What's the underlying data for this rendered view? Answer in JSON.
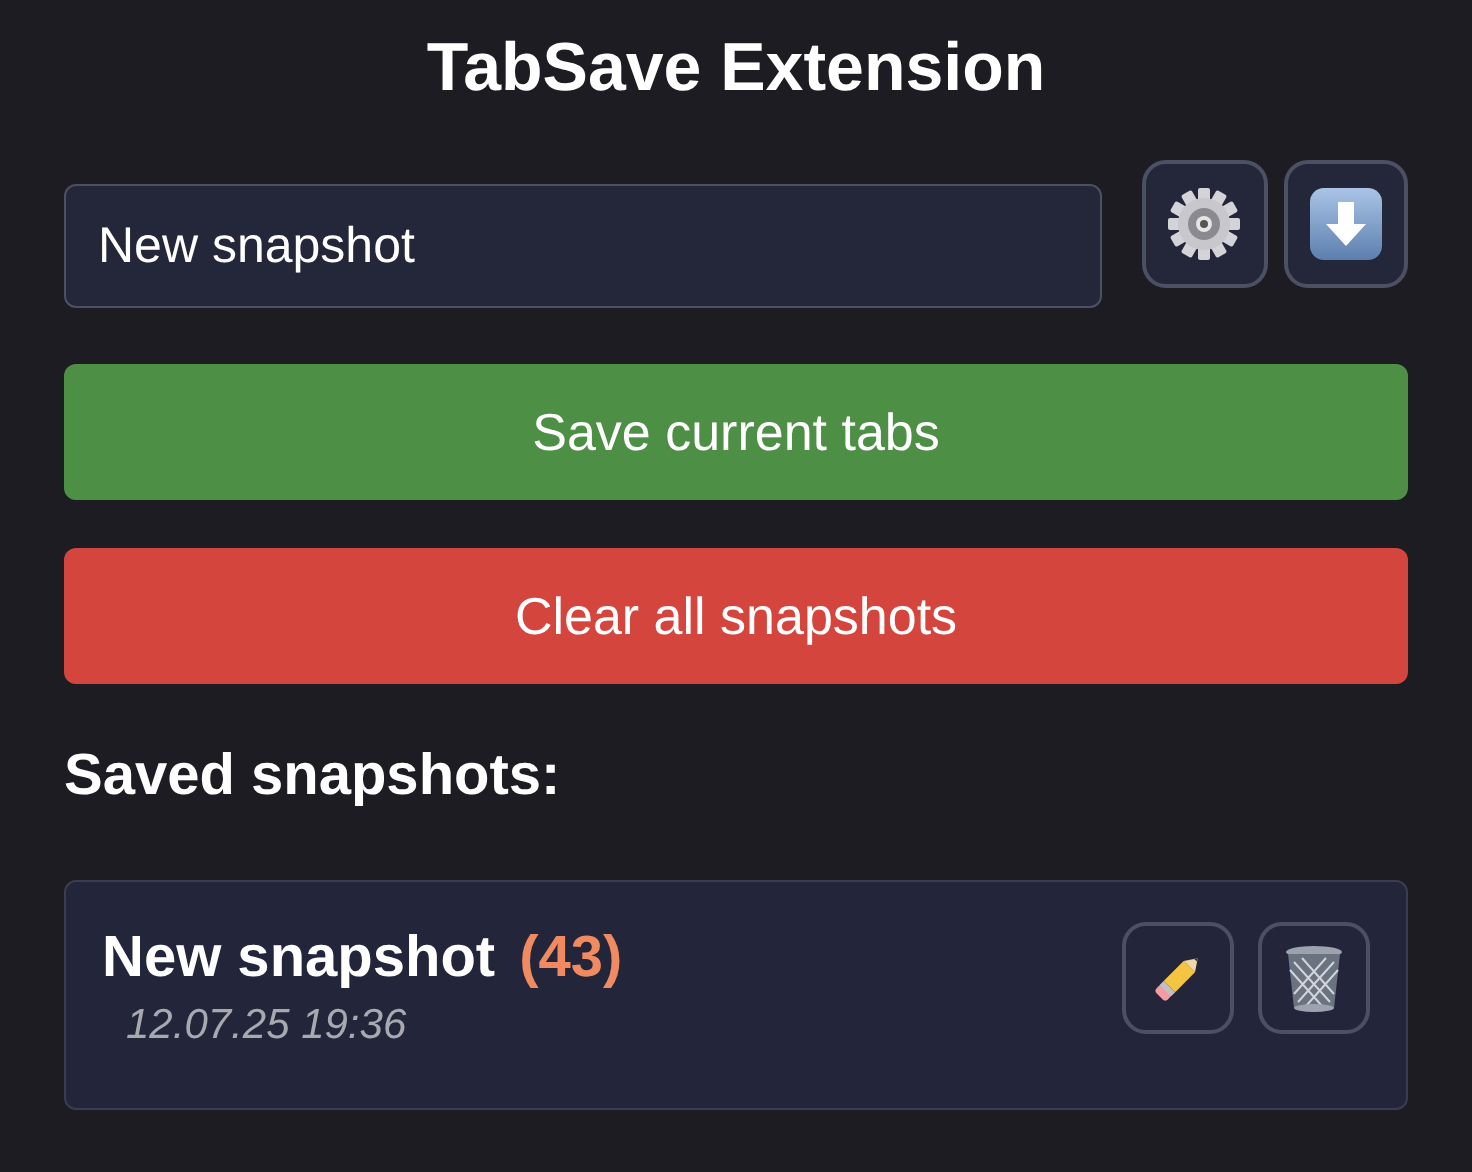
{
  "title": "TabSave Extension",
  "name_field": {
    "value": "New snapshot"
  },
  "save_button": "Save current tabs",
  "clear_button": "Clear all snapshots",
  "snapshots_heading": "Saved snapshots:",
  "snapshots": [
    {
      "name": "New snapshot",
      "count": "(43)",
      "date": "12.07.25 19:36"
    }
  ]
}
